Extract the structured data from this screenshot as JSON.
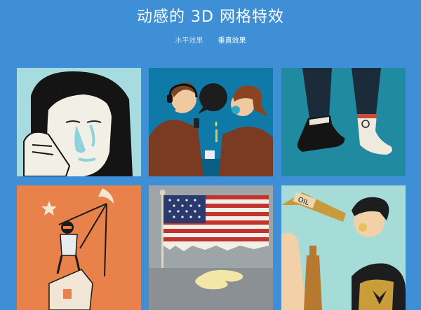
{
  "header": {
    "title": "动感的 3D 网格特效"
  },
  "tabs": [
    {
      "label": "水平效果",
      "active": false
    },
    {
      "label": "垂直效果",
      "active": true
    }
  ],
  "tiles": [
    {
      "name": "crying-woman",
      "bg": "#a6dce0"
    },
    {
      "name": "couple-conversation",
      "bg": "#0f7aa8"
    },
    {
      "name": "dangling-feet",
      "bg": "#1f8aa0"
    },
    {
      "name": "moon-puppet",
      "bg": "#e9824a"
    },
    {
      "name": "american-flag",
      "bg": "#9ea5a9",
      "label_flag": "flag"
    },
    {
      "name": "man-drinking-oil",
      "bg": "#a5dcd8",
      "bottle_label": "OIL"
    }
  ]
}
